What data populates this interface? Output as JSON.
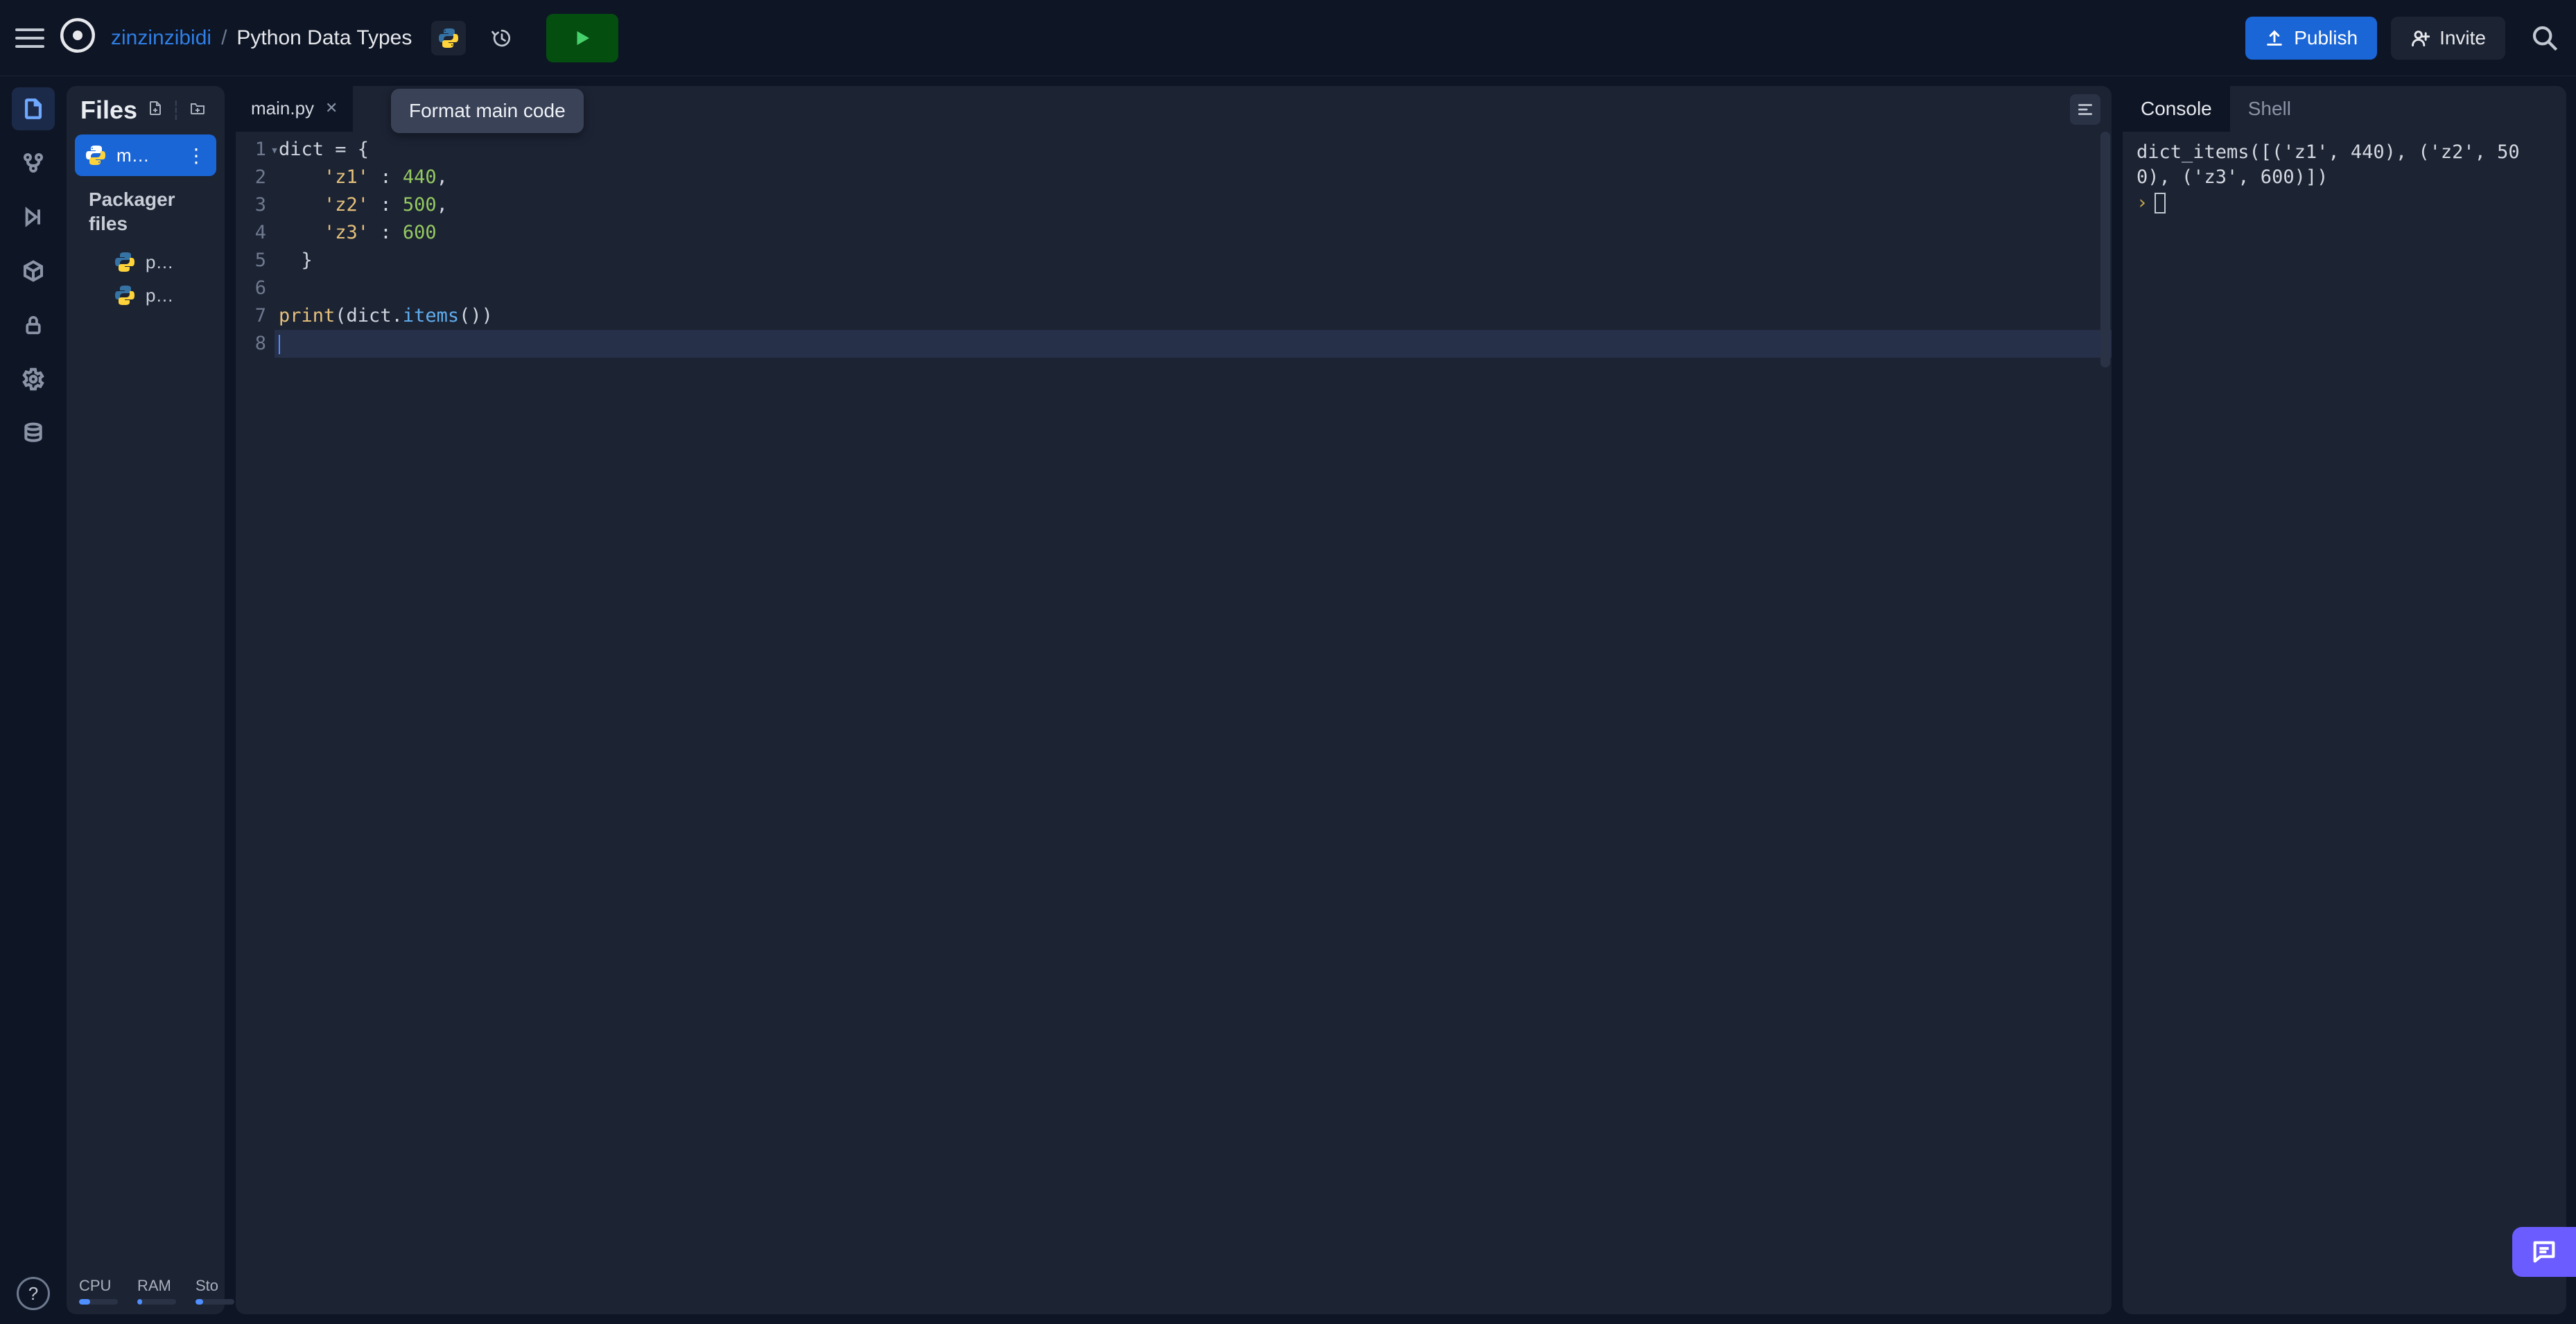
{
  "header": {
    "user": "zinzinzibidi",
    "separator": "/",
    "project": "Python Data Types",
    "publish_label": "Publish",
    "invite_label": "Invite"
  },
  "tooltip": {
    "text": "Format main code"
  },
  "sidebar": {
    "files_title": "Files",
    "active_file": "m…",
    "section_title": "Packager files",
    "pkg_files": [
      "p…",
      "p…"
    ],
    "meters": [
      {
        "label": "CPU",
        "pct": 28
      },
      {
        "label": "RAM",
        "pct": 12
      },
      {
        "label": "Sto",
        "pct": 20
      }
    ]
  },
  "editor": {
    "tab": {
      "name": "main.py"
    },
    "lines": [
      {
        "n": 1,
        "fold": true
      },
      {
        "n": 2
      },
      {
        "n": 3
      },
      {
        "n": 4
      },
      {
        "n": 5
      },
      {
        "n": 6
      },
      {
        "n": 7
      },
      {
        "n": 8,
        "hl": true
      }
    ],
    "code": {
      "l1_a": "dict ",
      "l1_b": "= {",
      "k1": "'z1'",
      "v1": "440",
      "k2": "'z2'",
      "v2": "500",
      "k3": "'z3'",
      "v3": "600",
      "rbrace": "  }",
      "print": "print",
      "lpar": "(",
      "obj": "dict",
      "dot": ".",
      "method": "items",
      "rpar": "())"
    }
  },
  "console": {
    "tabs": [
      "Console",
      "Shell"
    ],
    "output": "dict_items([('z1', 440), ('z2', 500), ('z3', 600)])",
    "prompt": "›"
  }
}
